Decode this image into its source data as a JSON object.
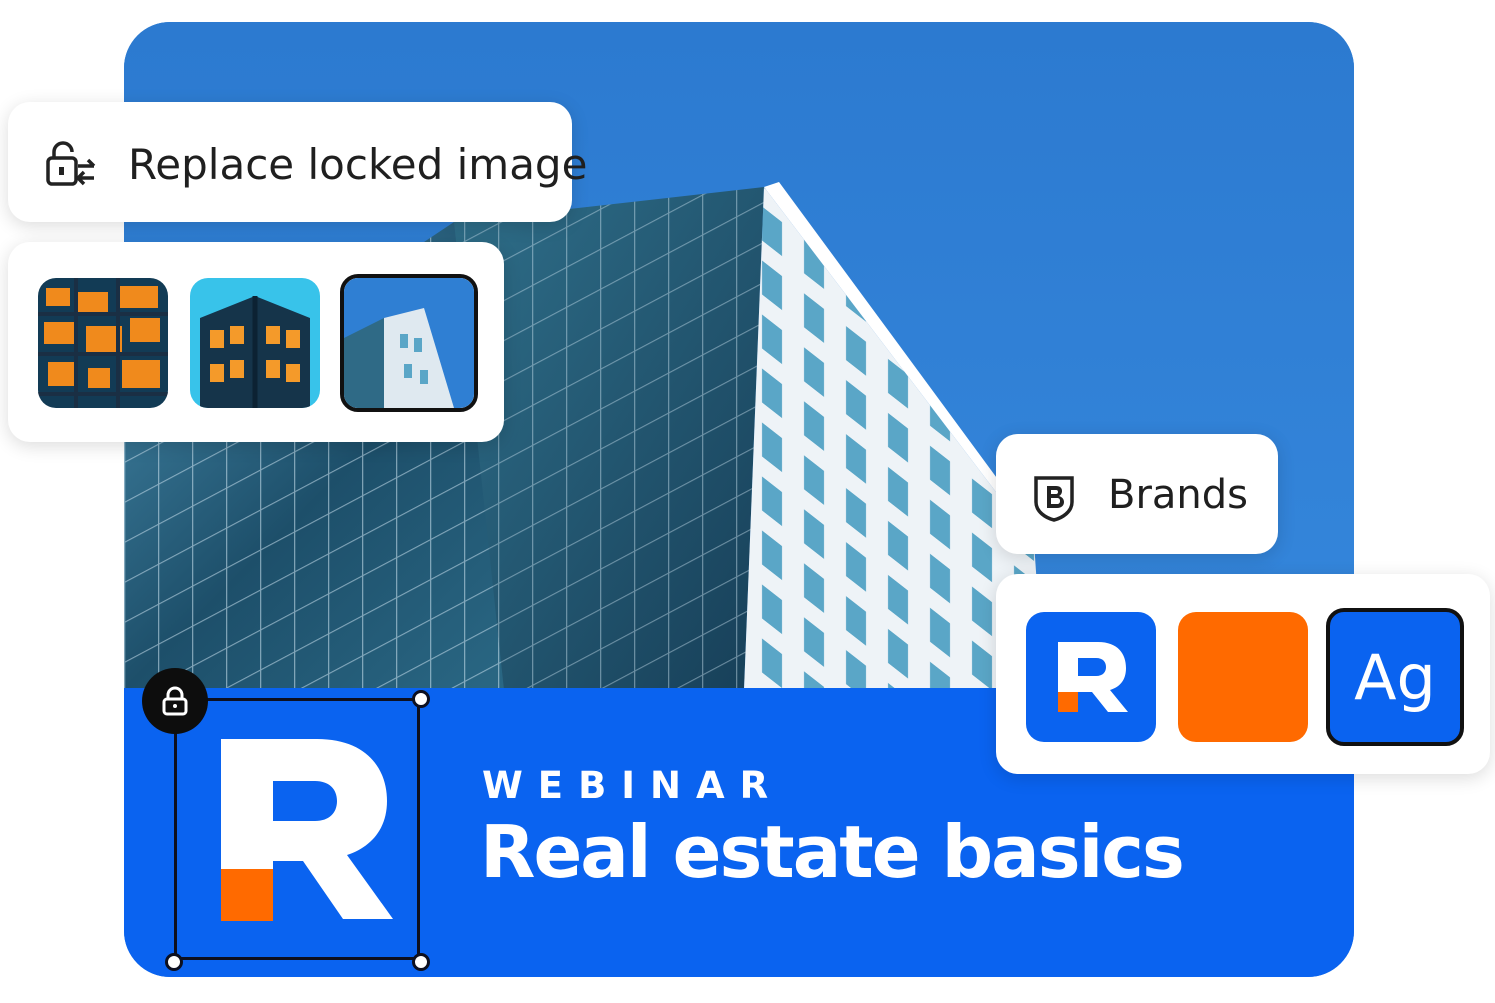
{
  "lock_panel": {
    "label": "Replace locked image",
    "icon": "lock-replace-icon"
  },
  "thumbnails": [
    {
      "name": "orange-windows-thumb",
      "selected": false
    },
    {
      "name": "building-corner-thumb",
      "selected": false
    },
    {
      "name": "skyscraper-thumb",
      "selected": true
    }
  ],
  "brands_panel": {
    "label": "Brands",
    "icon": "brand-shield-icon"
  },
  "brand_swatches": {
    "logo_letter": "R",
    "font_sample": "Ag",
    "colors": {
      "primary_blue": "#0a63f0",
      "accent_orange": "#ff6a00",
      "dark": "#0d1020"
    }
  },
  "banner": {
    "eyebrow": "WEBINAR",
    "title": "Real estate basics",
    "logo_letter": "R",
    "logo_locked": true
  }
}
